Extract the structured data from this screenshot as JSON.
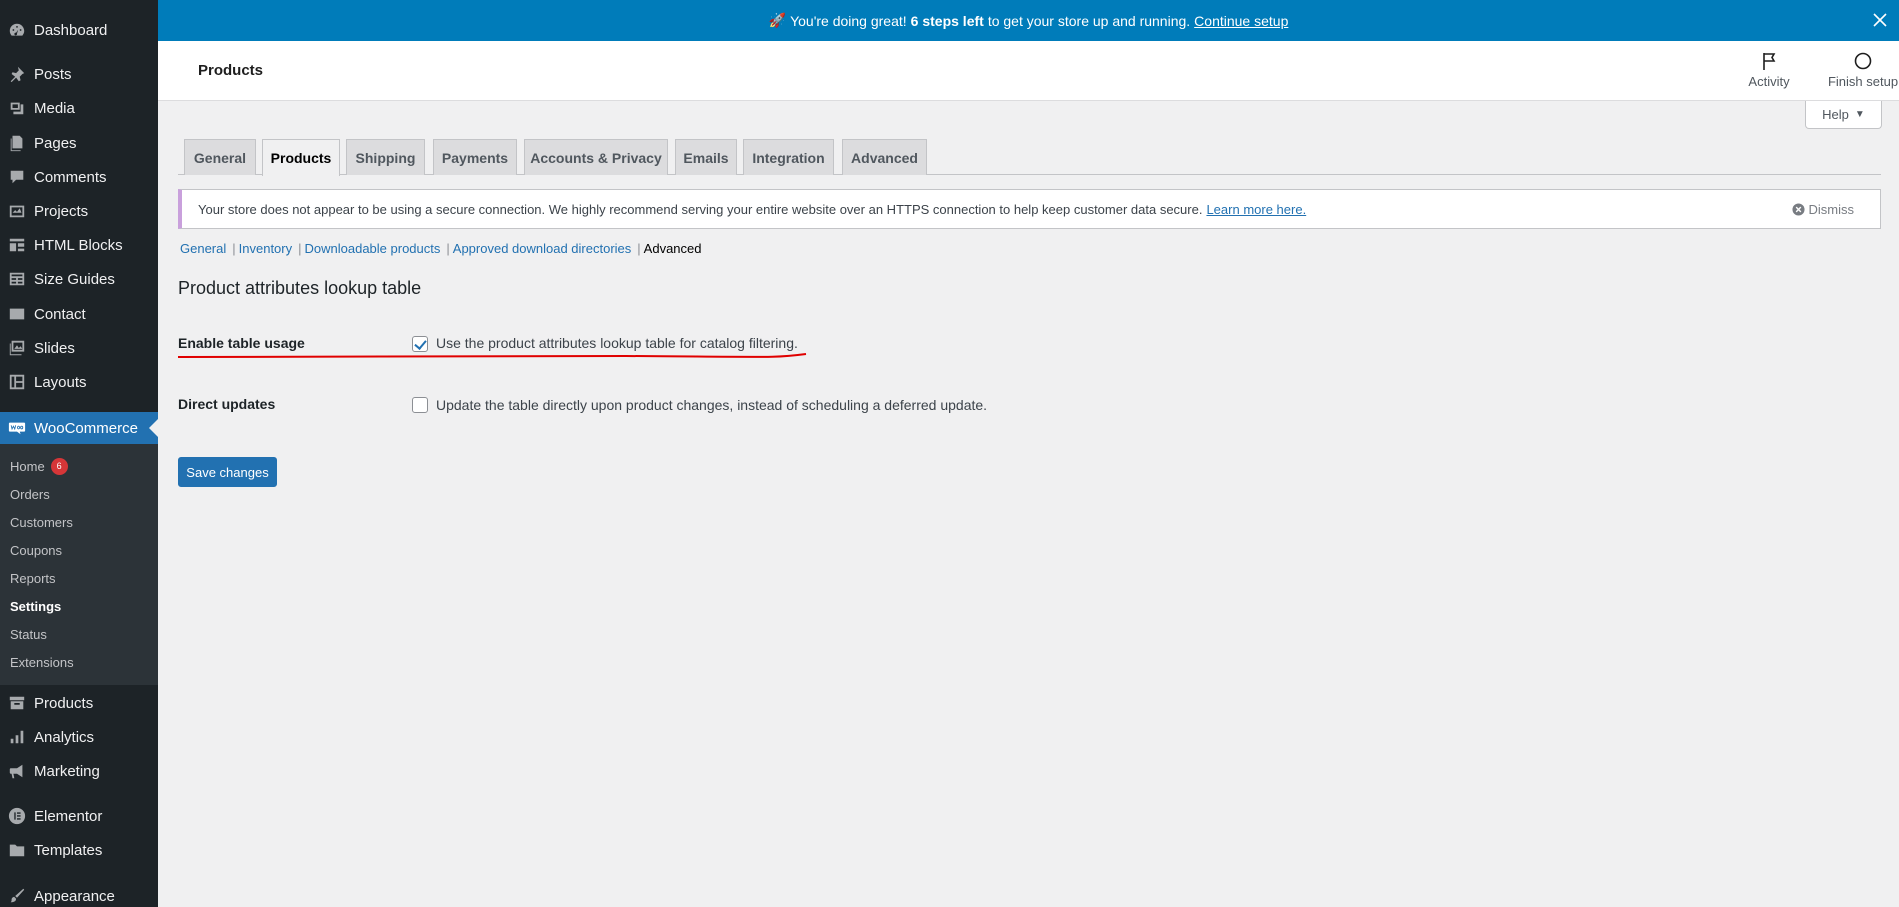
{
  "sidebar": {
    "items": [
      {
        "label": "Dashboard",
        "icon": "dashboard-icon"
      },
      {
        "label": "Posts",
        "icon": "pin-icon"
      },
      {
        "label": "Media",
        "icon": "media-icon"
      },
      {
        "label": "Pages",
        "icon": "pages-icon"
      },
      {
        "label": "Comments",
        "icon": "comments-icon"
      },
      {
        "label": "Projects",
        "icon": "portfolio-icon"
      },
      {
        "label": "HTML Blocks",
        "icon": "grid-icon"
      },
      {
        "label": "Size Guides",
        "icon": "table-icon"
      },
      {
        "label": "Contact",
        "icon": "mail-icon"
      },
      {
        "label": "Slides",
        "icon": "slides-icon"
      },
      {
        "label": "Layouts",
        "icon": "layouts-icon"
      },
      {
        "label": "WooCommerce",
        "icon": "woo-icon"
      },
      {
        "label": "Products",
        "icon": "archive-icon"
      },
      {
        "label": "Analytics",
        "icon": "bar-chart-icon"
      },
      {
        "label": "Marketing",
        "icon": "megaphone-icon"
      },
      {
        "label": "Elementor",
        "icon": "elementor-icon"
      },
      {
        "label": "Templates",
        "icon": "folder-icon"
      },
      {
        "label": "Appearance",
        "icon": "brush-icon"
      }
    ],
    "submenu": [
      {
        "label": "Home",
        "badge": "6"
      },
      {
        "label": "Orders"
      },
      {
        "label": "Customers"
      },
      {
        "label": "Coupons"
      },
      {
        "label": "Reports"
      },
      {
        "label": "Settings"
      },
      {
        "label": "Status"
      },
      {
        "label": "Extensions"
      }
    ]
  },
  "topbar": {
    "emoji": "🚀",
    "text_before": "You're doing great!",
    "bold": "6 steps left",
    "text_after": "to get your store up and running.",
    "link": "Continue setup"
  },
  "header": {
    "title": "Products",
    "activity": "Activity",
    "finish_setup": "Finish setup",
    "help": "Help"
  },
  "tabs": [
    "General",
    "Products",
    "Shipping",
    "Payments",
    "Accounts & Privacy",
    "Emails",
    "Integration",
    "Advanced"
  ],
  "active_tab": "Products",
  "notice": {
    "text": "Your store does not appear to be using a secure connection. We highly recommend serving your entire website over an HTTPS connection to help keep customer data secure.",
    "link": "Learn more here.",
    "dismiss": "Dismiss"
  },
  "subsub": [
    "General",
    "Inventory",
    "Downloadable products",
    "Approved download directories",
    "Advanced"
  ],
  "section_title": "Product attributes lookup table",
  "settings": [
    {
      "label": "Enable table usage",
      "checkbox_label": "Use the product attributes lookup table for catalog filtering.",
      "checked": true
    },
    {
      "label": "Direct updates",
      "checkbox_label": "Update the table directly upon product changes, instead of scheduling a deferred update.",
      "checked": false
    }
  ],
  "save_label": "Save changes",
  "colors": {
    "accent": "#2271b1",
    "topbar": "#007cba",
    "sidebar": "#1d2327",
    "annotation": "#e00000"
  }
}
